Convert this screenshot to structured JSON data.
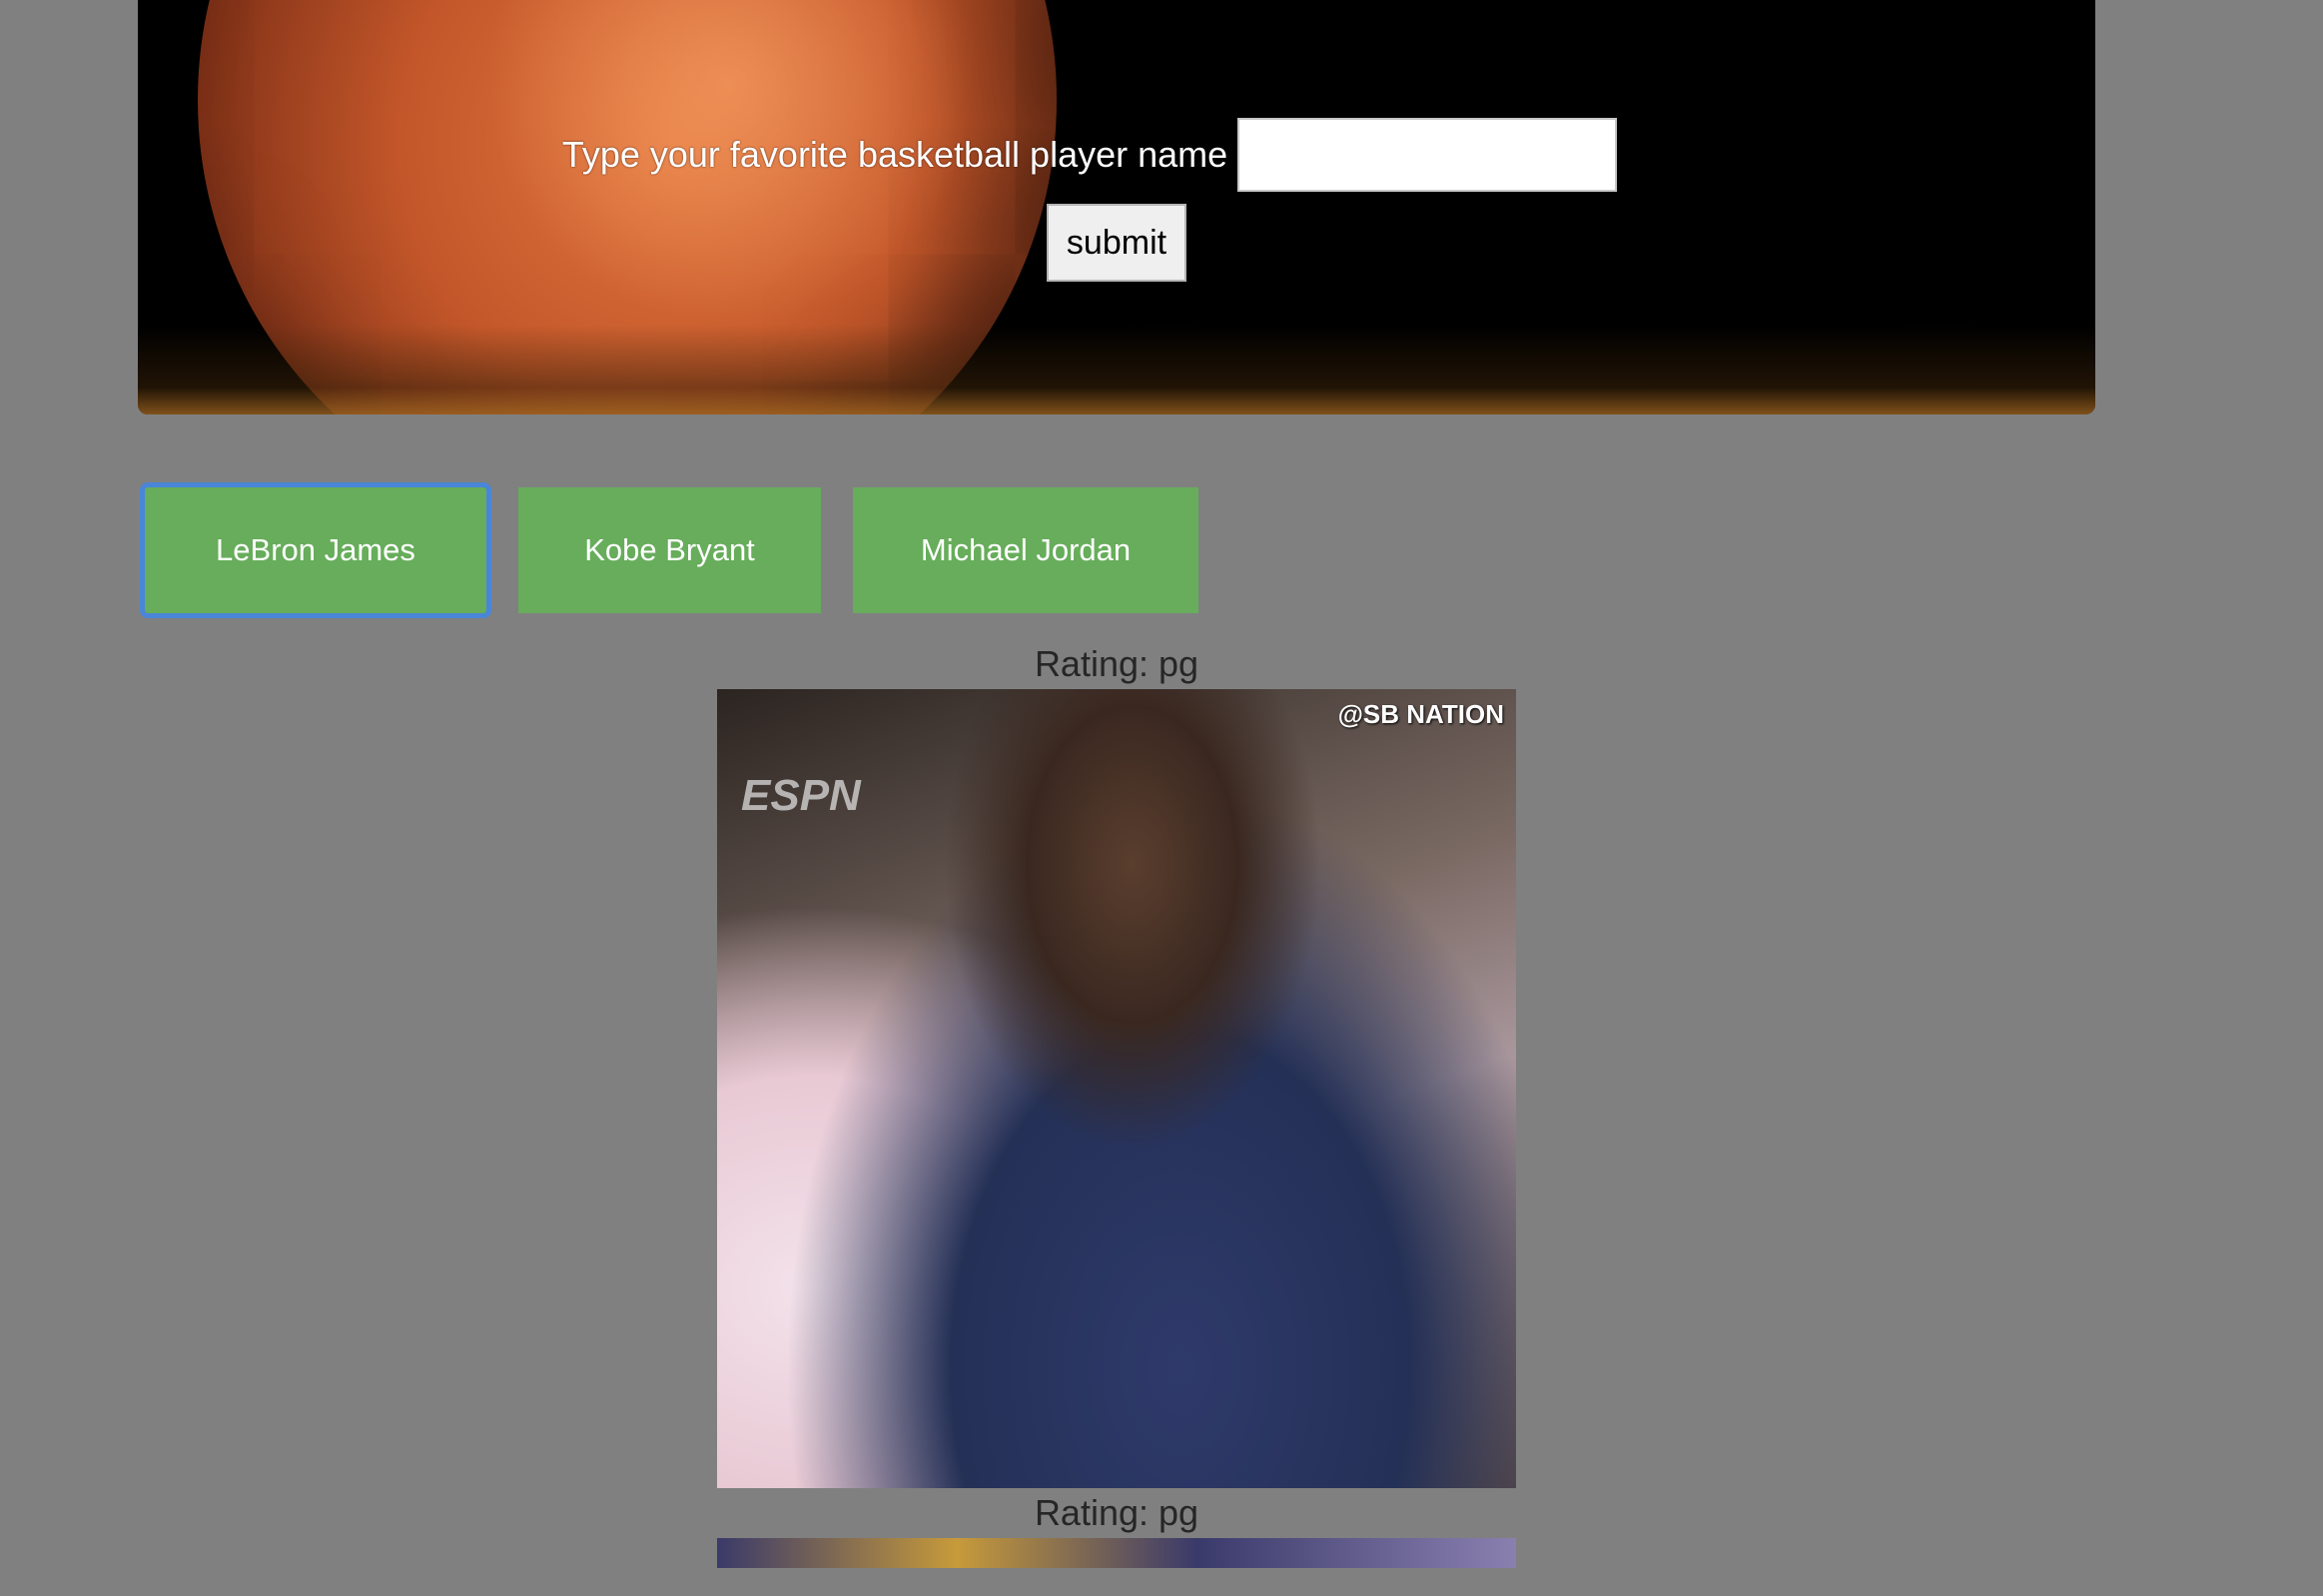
{
  "hero": {
    "prompt_label": "Type your favorite basketball player name",
    "input_value": "",
    "submit_label": "submit"
  },
  "player_buttons": [
    {
      "label": "LeBron James",
      "focused": true
    },
    {
      "label": "Kobe Bryant",
      "focused": false
    },
    {
      "label": "Michael Jordan",
      "focused": false
    }
  ],
  "results": [
    {
      "rating": "Rating: pg",
      "watermark": "@SB NATION",
      "network_logo": "ESPN"
    },
    {
      "rating": "Rating: pg"
    }
  ],
  "colors": {
    "page_background": "#808080",
    "player_button": "#67ad5b",
    "focus_outline": "#4a86d8"
  }
}
